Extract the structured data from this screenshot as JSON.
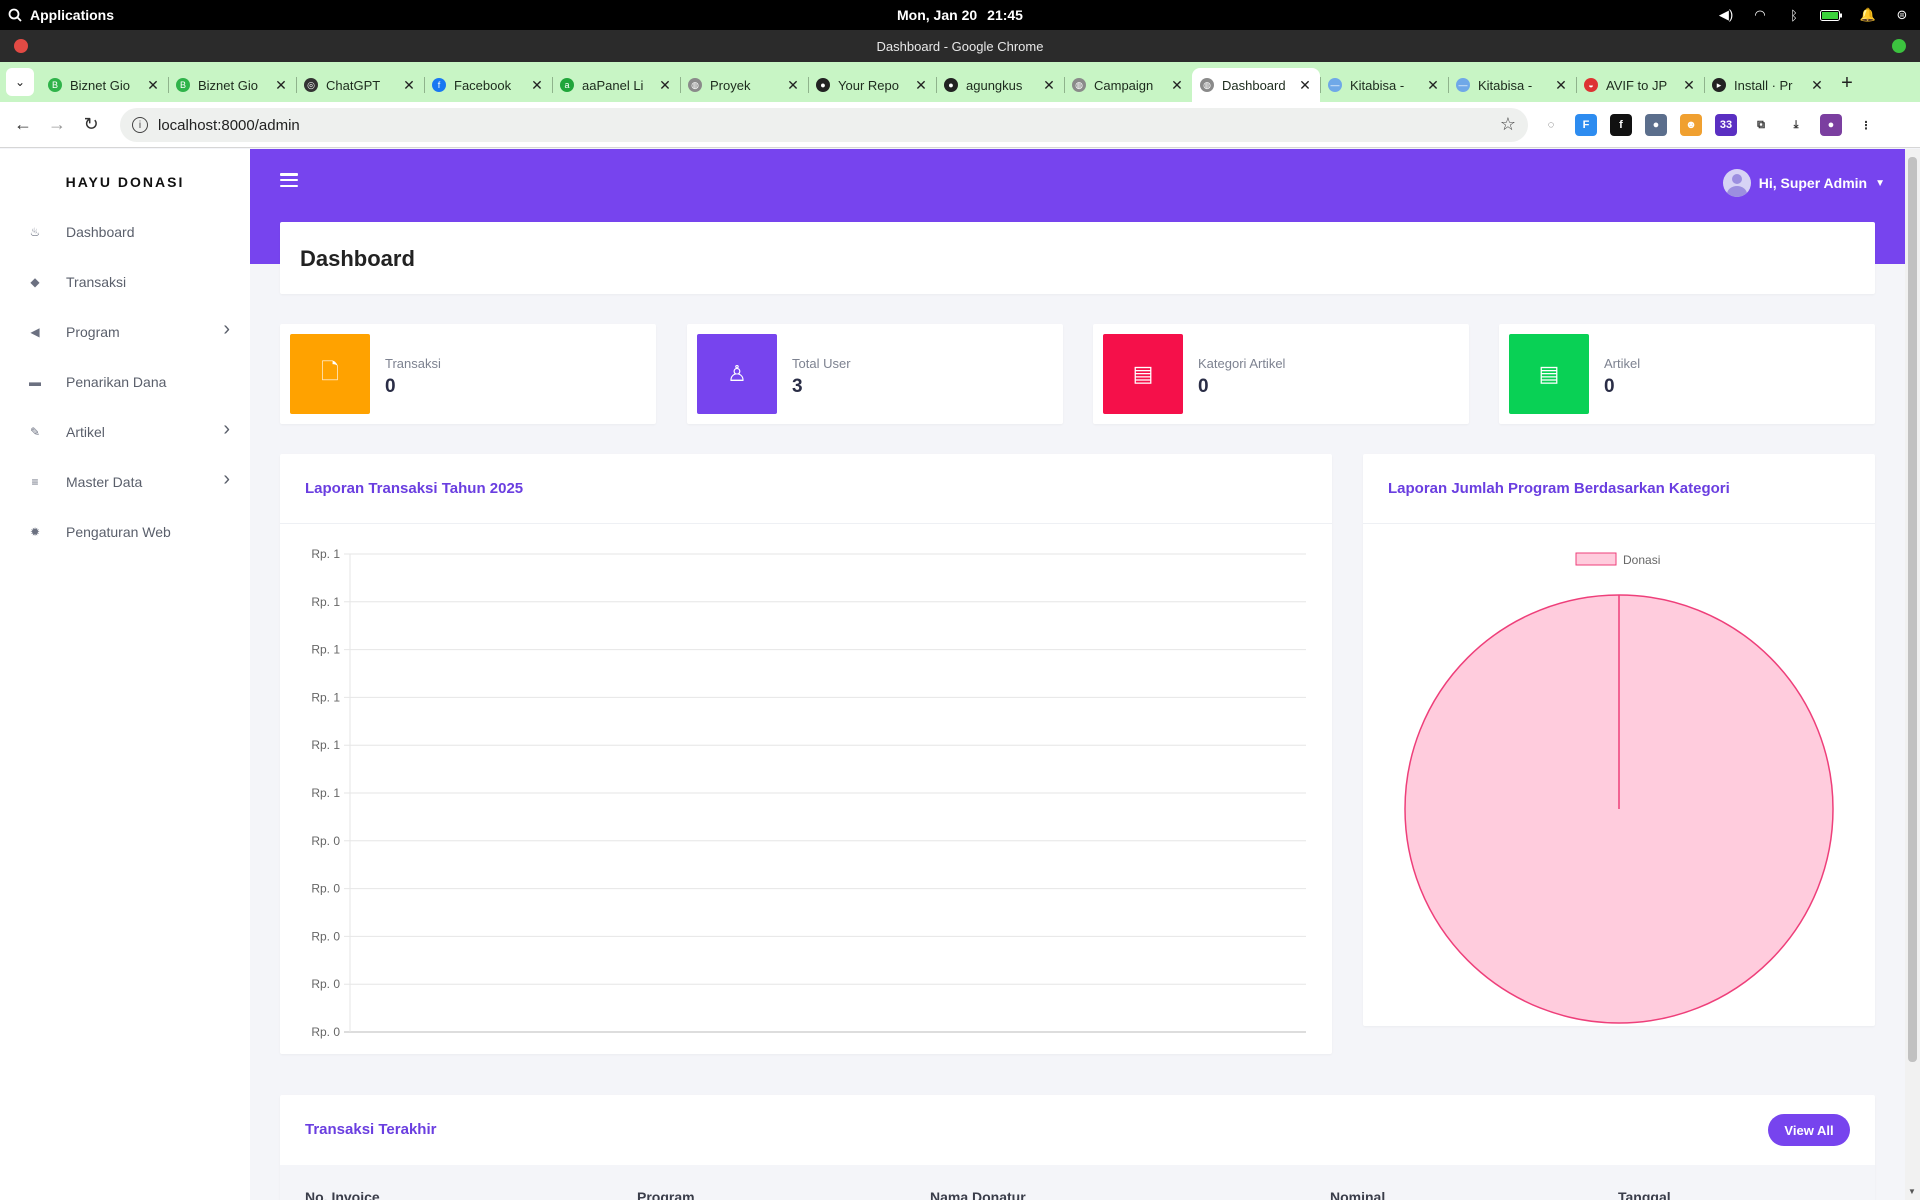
{
  "os": {
    "apps_label": "Applications",
    "date": "Mon, Jan 20",
    "time": "21:45"
  },
  "window": {
    "title": "Dashboard - Google Chrome"
  },
  "tabs": [
    {
      "title": "Biznet Gio",
      "color": "#2fb34a",
      "glyph": "B"
    },
    {
      "title": "Biznet Gio",
      "color": "#2fb34a",
      "glyph": "B"
    },
    {
      "title": "ChatGPT",
      "color": "#333333",
      "glyph": "◎"
    },
    {
      "title": "Facebook",
      "color": "#1877f2",
      "glyph": "f"
    },
    {
      "title": "aaPanel Li",
      "color": "#20a53a",
      "glyph": "a"
    },
    {
      "title": "Proyek",
      "color": "#8a8a8a",
      "glyph": "◍"
    },
    {
      "title": "Your Repo",
      "color": "#222222",
      "glyph": "●"
    },
    {
      "title": "agungkus",
      "color": "#222222",
      "glyph": "●"
    },
    {
      "title": "Campaign",
      "color": "#8a8a8a",
      "glyph": "◍"
    },
    {
      "title": "Dashboard",
      "color": "#8a8a8a",
      "glyph": "◍",
      "active": true
    },
    {
      "title": "Kitabisa -",
      "color": "#6fa8e8",
      "glyph": "—"
    },
    {
      "title": "Kitabisa -",
      "color": "#6fa8e8",
      "glyph": "—"
    },
    {
      "title": "AVIF to JP",
      "color": "#d33",
      "glyph": "◒"
    },
    {
      "title": "Install · Pr",
      "color": "#222222",
      "glyph": "▸"
    }
  ],
  "address_bar": {
    "url": "localhost:8000/admin"
  },
  "extensions": [
    {
      "name": "ext-1",
      "color": "#ffffff",
      "text": "◌",
      "fg": "#444444"
    },
    {
      "name": "ext-2",
      "color": "#2d8cf0",
      "text": "F",
      "fg": "#ffffff"
    },
    {
      "name": "ext-3",
      "color": "#111111",
      "text": "f",
      "fg": "#ffffff"
    },
    {
      "name": "ext-4",
      "color": "#5b6e8c",
      "text": "●",
      "fg": "#ffffff"
    },
    {
      "name": "ext-5",
      "color": "#f0a030",
      "text": "☻",
      "fg": "#ffffff"
    },
    {
      "name": "ext-6",
      "color": "#5a2fc2",
      "text": "33",
      "fg": "#ffffff"
    },
    {
      "name": "ext-7",
      "color": "#ffffff",
      "text": "⧉",
      "fg": "#333333"
    },
    {
      "name": "ext-8",
      "color": "#ffffff",
      "text": "⤓",
      "fg": "#333333"
    },
    {
      "name": "ext-9",
      "color": "#7b3fa0",
      "text": "●",
      "fg": "#ffffff"
    },
    {
      "name": "ext-10",
      "color": "#ffffff",
      "text": "⋮",
      "fg": "#333333"
    }
  ],
  "sidebar": {
    "brand": "HAYU DONASI",
    "items": [
      {
        "label": "Dashboard",
        "icon": "fire-icon",
        "glyph": "♨",
        "arrow": false
      },
      {
        "label": "Transaksi",
        "icon": "tags-icon",
        "glyph": "◆",
        "arrow": false
      },
      {
        "label": "Program",
        "icon": "bullhorn-icon",
        "glyph": "◀",
        "arrow": true
      },
      {
        "label": "Penarikan Dana",
        "icon": "money-icon",
        "glyph": "▬",
        "arrow": false
      },
      {
        "label": "Artikel",
        "icon": "blog-icon",
        "glyph": "✎",
        "arrow": true
      },
      {
        "label": "Master Data",
        "icon": "database-icon",
        "glyph": "≡",
        "arrow": true
      },
      {
        "label": "Pengaturan Web",
        "icon": "cog-icon",
        "glyph": "✹",
        "arrow": false
      }
    ]
  },
  "header": {
    "user_greeting": "Hi, Super Admin"
  },
  "page": {
    "title": "Dashboard"
  },
  "stats": [
    {
      "label": "Transaksi",
      "value": "0",
      "color": "#ffa200",
      "icon": "file-icon",
      "glyph": "🗋"
    },
    {
      "label": "Total User",
      "value": "3",
      "color": "#7744ee",
      "icon": "user-icon",
      "glyph": "♙"
    },
    {
      "label": "Kategori Artikel",
      "value": "0",
      "color": "#f5104a",
      "icon": "newspaper-icon",
      "glyph": "▤"
    },
    {
      "label": "Artikel",
      "value": "0",
      "color": "#09d155",
      "icon": "newspaper-icon",
      "glyph": "▤"
    }
  ],
  "line_chart": {
    "title": "Laporan Transaksi Tahun 2025",
    "chart_data": {
      "type": "line",
      "y_tick_labels": [
        "Rp. 1",
        "Rp. 1",
        "Rp. 1",
        "Rp. 1",
        "Rp. 1",
        "Rp. 1",
        "Rp. 0",
        "Rp. 0",
        "Rp. 0",
        "Rp. 0",
        "Rp. 0"
      ],
      "ylim": [
        0,
        1
      ],
      "series": [],
      "grid": true
    }
  },
  "pie_chart": {
    "title": "Laporan Jumlah Program Berdasarkan Kategori",
    "chart_data": {
      "type": "pie",
      "labels": [
        "Donasi"
      ],
      "values": [
        1
      ],
      "colors": [
        "#ffccdd"
      ],
      "border_color": "#ee3f7a",
      "legend": "top"
    }
  },
  "recent_transactions": {
    "title": "Transaksi Terakhir",
    "view_all": "View All",
    "columns": [
      "No. Invoice",
      "Program",
      "Nama Donatur",
      "Nominal",
      "Tanggal"
    ]
  }
}
